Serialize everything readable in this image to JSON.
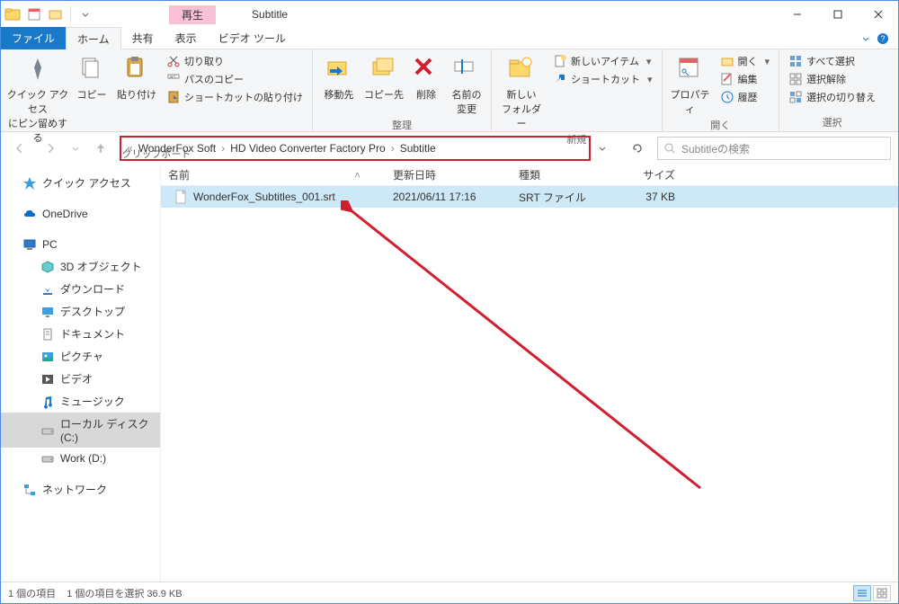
{
  "window": {
    "title": "Subtitle",
    "context_tab_title": "再生"
  },
  "ribbon": {
    "file": "ファイル",
    "tabs": [
      "ホーム",
      "共有",
      "表示"
    ],
    "context_tab": "ビデオ ツール",
    "active_tab": "ホーム",
    "groups": {
      "clipboard": {
        "label": "クリップボード",
        "pin": "クイック アクセス\nにピン留めする",
        "copy": "コピー",
        "paste": "貼り付け",
        "cut": "切り取り",
        "copy_path": "パスのコピー",
        "paste_shortcut": "ショートカットの貼り付け"
      },
      "organize": {
        "label": "整理",
        "move": "移動先",
        "copy_to": "コピー先",
        "delete": "削除",
        "rename": "名前の\n変更"
      },
      "new": {
        "label": "新規",
        "new_folder": "新しい\nフォルダー",
        "new_item": "新しいアイテム",
        "shortcut": "ショートカット"
      },
      "open": {
        "label": "開く",
        "properties": "プロパティ",
        "open": "開く",
        "edit": "編集",
        "history": "履歴"
      },
      "select": {
        "label": "選択",
        "select_all": "すべて選択",
        "select_none": "選択解除",
        "invert": "選択の切り替え"
      }
    }
  },
  "breadcrumb": {
    "segments": [
      "WonderFox Soft",
      "HD Video Converter Factory Pro",
      "Subtitle"
    ]
  },
  "search": {
    "placeholder": "Subtitleの検索"
  },
  "columns": {
    "name": "名前",
    "date": "更新日時",
    "type": "種類",
    "size": "サイズ"
  },
  "files": [
    {
      "name": "WonderFox_Subtitles_001.srt",
      "date": "2021/06/11 17:16",
      "type": "SRT ファイル",
      "size": "37 KB"
    }
  ],
  "sidebar": {
    "quick_access": "クイック アクセス",
    "onedrive": "OneDrive",
    "pc": "PC",
    "pc_items": [
      "3D オブジェクト",
      "ダウンロード",
      "デスクトップ",
      "ドキュメント",
      "ピクチャ",
      "ビデオ",
      "ミュージック",
      "ローカル ディスク (C:)",
      "Work (D:)"
    ],
    "network": "ネットワーク"
  },
  "status": {
    "count": "1 個の項目",
    "selection": "1 個の項目を選択 36.9 KB"
  }
}
